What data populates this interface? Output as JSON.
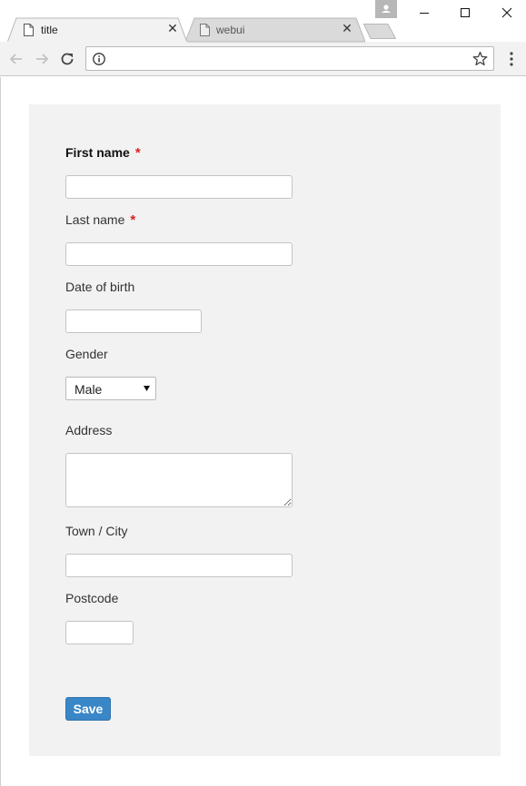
{
  "browser": {
    "tabs": [
      {
        "label": "title",
        "active": true
      },
      {
        "label": "webui",
        "active": false
      }
    ],
    "address_bar": {
      "url": ""
    }
  },
  "form": {
    "first_name": {
      "label": "First name",
      "required_mark": "*",
      "value": ""
    },
    "last_name": {
      "label": "Last name",
      "required_mark": "*",
      "value": ""
    },
    "date_of_birth": {
      "label": "Date of birth",
      "value": ""
    },
    "gender": {
      "label": "Gender",
      "selected": "Male"
    },
    "address": {
      "label": "Address",
      "value": ""
    },
    "town_city": {
      "label": "Town / City",
      "value": ""
    },
    "postcode": {
      "label": "Postcode",
      "value": ""
    },
    "save_label": "Save"
  },
  "colors": {
    "panel_background": "#f2f2f2",
    "required_mark": "#e02020",
    "save_button": "#3a87c8"
  },
  "icons": [
    "document-icon",
    "close-icon",
    "new-tab-icon",
    "profile-icon",
    "minimize-icon",
    "maximize-icon",
    "window-close-icon",
    "back-arrow-icon",
    "forward-arrow-icon",
    "reload-icon",
    "info-icon",
    "star-icon",
    "more-menu-icon",
    "dropdown-arrow-icon"
  ]
}
